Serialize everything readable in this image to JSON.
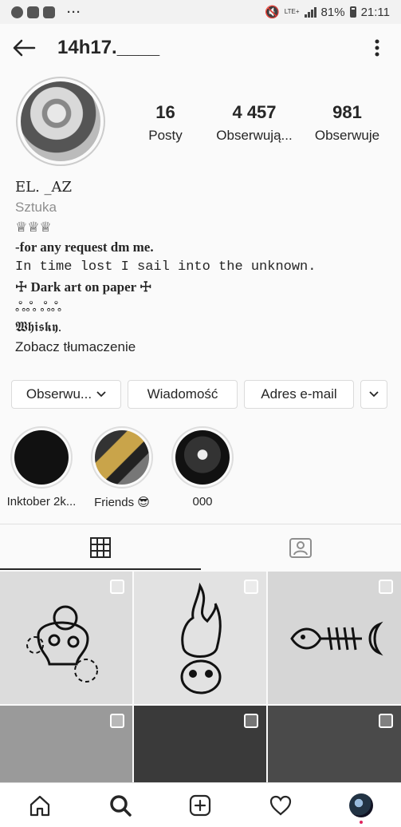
{
  "status_bar": {
    "battery": "81%",
    "time": "21:11",
    "network": "LTE+"
  },
  "header": {
    "username": "14h17.____"
  },
  "profile": {
    "stats": [
      {
        "value": "16",
        "label": "Posty"
      },
      {
        "value": "4 457",
        "label": "Obserwują..."
      },
      {
        "value": "981",
        "label": "Obserwuje"
      }
    ],
    "name": "EL. _AZ",
    "category": "Sztuka",
    "bio_lines": [
      "♕♕♕",
      "-for any request dm me.",
      "In time lost I sail into the unknown.",
      "☩ Dark art on paper ☩",
      "ஃஃ ஃஃ",
      "𝖂𝖍𝖎𝖘𝖐𝖞."
    ],
    "translate_link": "Zobacz tłumaczenie"
  },
  "actions": {
    "follow": "Obserwu...",
    "message": "Wiadomość",
    "email": "Adres e-mail"
  },
  "highlights": [
    {
      "label": "Inktober 2k..."
    },
    {
      "label": "Friends 😎"
    },
    {
      "label": "000"
    }
  ],
  "accent": "#e0245e"
}
